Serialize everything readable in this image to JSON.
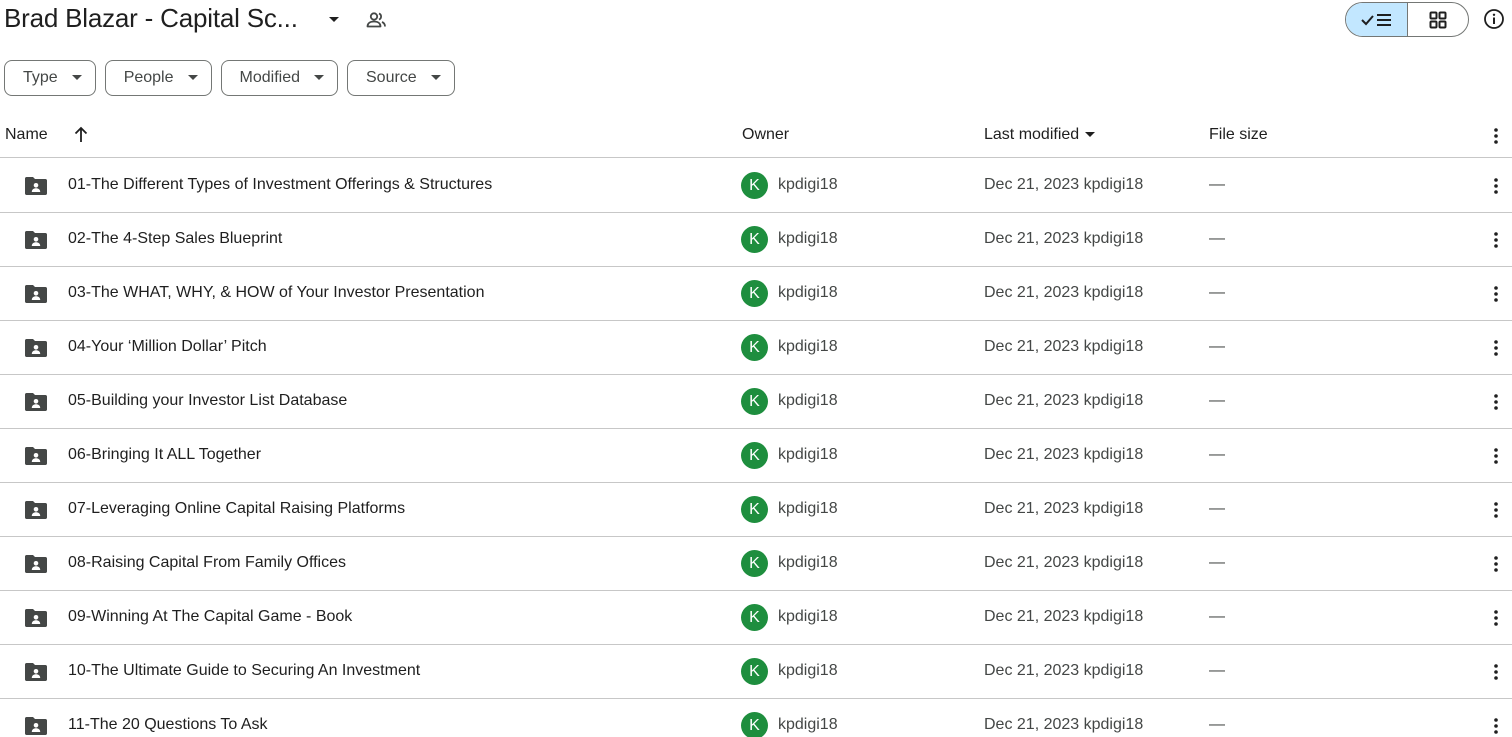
{
  "header": {
    "title": "Brad Blazar - Capital Sc...",
    "title_caret_icon": "arrow-drop-down-icon",
    "share_icon": "people-icon",
    "view_list_icon": "check-list-icon",
    "view_grid_icon": "grid-icon",
    "info_icon": "info-icon"
  },
  "filters": [
    {
      "label": "Type"
    },
    {
      "label": "People"
    },
    {
      "label": "Modified"
    },
    {
      "label": "Source"
    }
  ],
  "columns": {
    "name": "Name",
    "owner": "Owner",
    "modified": "Last modified",
    "size": "File size"
  },
  "rows": [
    {
      "name": "01-The Different Types of Investment Offerings & Structures",
      "avatar": "K",
      "owner": "kpdigi18",
      "modified": "Dec 21, 2023 kpdigi18",
      "size": "—"
    },
    {
      "name": "02-The 4-Step Sales Blueprint",
      "avatar": "K",
      "owner": "kpdigi18",
      "modified": "Dec 21, 2023 kpdigi18",
      "size": "—"
    },
    {
      "name": "03-The WHAT, WHY, & HOW of Your Investor Presentation",
      "avatar": "K",
      "owner": "kpdigi18",
      "modified": "Dec 21, 2023 kpdigi18",
      "size": "—"
    },
    {
      "name": "04-Your ‘Million Dollar’ Pitch",
      "avatar": "K",
      "owner": "kpdigi18",
      "modified": "Dec 21, 2023 kpdigi18",
      "size": "—"
    },
    {
      "name": "05-Building your Investor List Database",
      "avatar": "K",
      "owner": "kpdigi18",
      "modified": "Dec 21, 2023 kpdigi18",
      "size": "—"
    },
    {
      "name": "06-Bringing It ALL Together",
      "avatar": "K",
      "owner": "kpdigi18",
      "modified": "Dec 21, 2023 kpdigi18",
      "size": "—"
    },
    {
      "name": "07-Leveraging Online Capital Raising Platforms",
      "avatar": "K",
      "owner": "kpdigi18",
      "modified": "Dec 21, 2023 kpdigi18",
      "size": "—"
    },
    {
      "name": "08-Raising Capital From Family Offices",
      "avatar": "K",
      "owner": "kpdigi18",
      "modified": "Dec 21, 2023 kpdigi18",
      "size": "—"
    },
    {
      "name": "09-Winning At The Capital Game - Book",
      "avatar": "K",
      "owner": "kpdigi18",
      "modified": "Dec 21, 2023 kpdigi18",
      "size": "—"
    },
    {
      "name": "10-The Ultimate Guide to Securing An Investment",
      "avatar": "K",
      "owner": "kpdigi18",
      "modified": "Dec 21, 2023 kpdigi18",
      "size": "—"
    },
    {
      "name": "11-The 20 Questions To Ask",
      "avatar": "K",
      "owner": "kpdigi18",
      "modified": "Dec 21, 2023 kpdigi18",
      "size": "—"
    }
  ],
  "colors": {
    "accent": "#c2e7ff",
    "avatar": "#1e8e3e",
    "border": "#747775",
    "divider": "#c7c7c7"
  }
}
